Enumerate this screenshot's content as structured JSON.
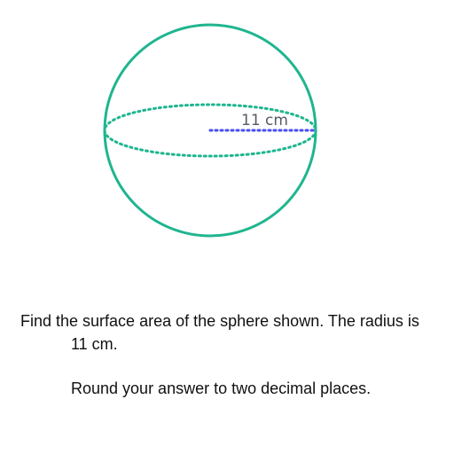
{
  "diagram": {
    "radius_label": "11 cm",
    "colors": {
      "sphere": "#1fb58f",
      "radius": "#4a4ef0",
      "label": "#555a66"
    }
  },
  "question": {
    "line1": "Find the surface area of the sphere shown. The radius is",
    "line2": "11 cm.",
    "instruction": "Round your answer to two decimal places."
  }
}
